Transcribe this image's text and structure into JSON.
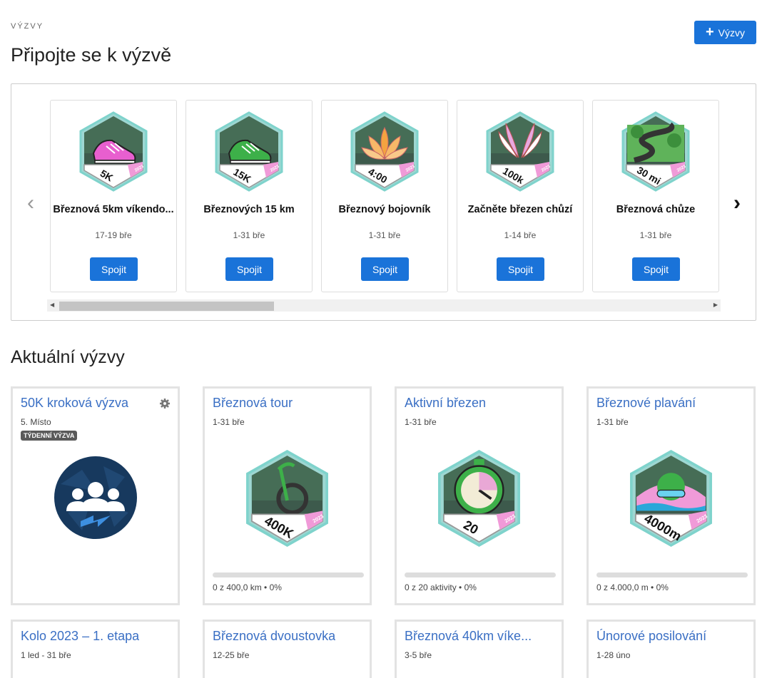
{
  "header": {
    "eyebrow": "VÝZVY",
    "title": "Připojte se k výzvě",
    "add_button": "Výzvy"
  },
  "carousel": {
    "join_label": "Spojit",
    "items": [
      {
        "title": "Březnová 5km víkendo...",
        "date": "17-19 bře",
        "badge_text": "5K",
        "year": "2023",
        "icon": "shoe-icon",
        "color": "#e85fcf"
      },
      {
        "title": "Březnových 15 km",
        "date": "1-31 bře",
        "badge_text": "15K",
        "year": "2023",
        "icon": "shoe-icon",
        "color": "#3db049"
      },
      {
        "title": "Březnový bojovník",
        "date": "1-31 bře",
        "badge_text": "4:00",
        "year": "2023",
        "icon": "lotus-icon",
        "color": "#f4a340"
      },
      {
        "title": "Začněte březen chůzí",
        "date": "1-14 bře",
        "badge_text": "100k",
        "year": "2023",
        "icon": "wings-icon",
        "color": "#e8a8e0"
      },
      {
        "title": "Březnová chůze",
        "date": "1-31 bře",
        "badge_text": "30 mi",
        "year": "2023",
        "icon": "path-icon",
        "color": "#6fc46a"
      }
    ]
  },
  "current": {
    "title": "Aktuální výzvy",
    "cards": [
      {
        "title": "50K kroková výzva",
        "date": "5. Místo",
        "tag": "TÝDENNÍ VÝZVA",
        "kind": "group"
      },
      {
        "title": "Březnová tour",
        "date": "1-31 bře",
        "badge_text": "400K",
        "year": "2023",
        "icon": "bike-icon",
        "progress_text": "0 z 400,0 km • 0%",
        "progress": 0
      },
      {
        "title": "Aktivní březen",
        "date": "1-31 bře",
        "badge_text": "20",
        "year": "2023",
        "icon": "stopwatch-icon",
        "progress_text": "0 z 20 aktivity • 0%",
        "progress": 0
      },
      {
        "title": "Březnové plavání",
        "date": "1-31 bře",
        "badge_text": "4000m",
        "year": "2023",
        "icon": "swimmer-icon",
        "progress_text": "0 z 4.000,0 m • 0%",
        "progress": 0
      },
      {
        "title": "Kolo 2023 – 1. etapa",
        "date": "1 led - 31 bře"
      },
      {
        "title": "Březnová dvoustovka",
        "date": "12-25 bře"
      },
      {
        "title": "Březnová 40km víke...",
        "date": "3-5 bře"
      },
      {
        "title": "Únorové posilování",
        "date": "1-28 úno"
      }
    ]
  }
}
